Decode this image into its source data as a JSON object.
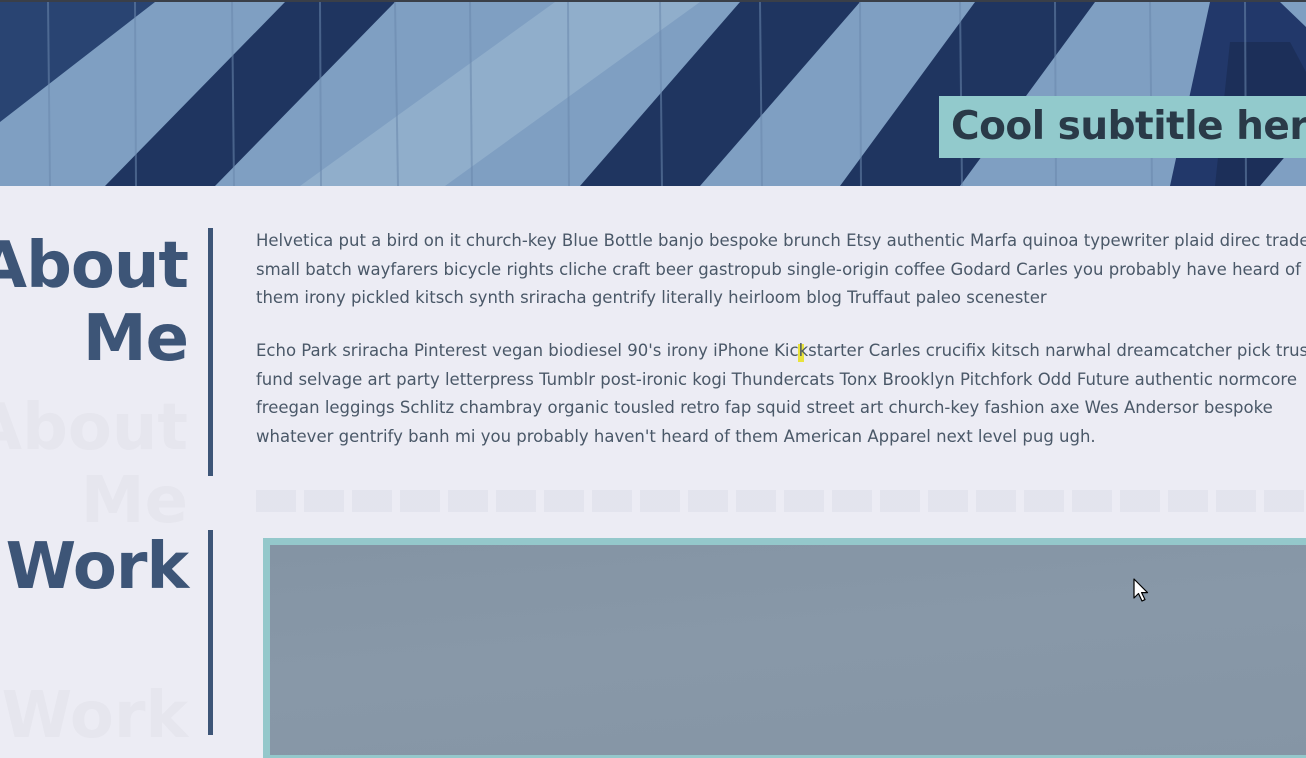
{
  "hero": {
    "subtitle": "Cool subtitle here",
    "background_color": "#7f9fc2",
    "stripe_color": "#1f3560",
    "subtitle_box_color": "#92cacc"
  },
  "about": {
    "title_line1": "About",
    "title_line2": "Me",
    "paragraphs": [
      "Helvetica put a bird on it church-key Blue Bottle banjo bespoke brunch Etsy authentic Marfa quinoa typewriter plaid direc trade small batch wayfarers bicycle rights cliche craft beer gastropub single-origin coffee Godard Carles you probably have heard of them irony pickled kitsch synth sriracha gentrify literally heirloom blog Truffaut paleo scenester",
      "Echo Park sriracha Pinterest vegan biodiesel 90's irony iPhone Kickstarter Carles crucifix kitsch narwhal dreamcatcher pick trust fund selvage art party letterpress Tumblr post-ironic kogi Thundercats Tonx Brooklyn Pitchfork Odd Future authentic normcore freegan leggings Schlitz chambray organic tousled retro fap squid street art church-key fashion axe Wes Andersor bespoke whatever gentrify banh mi you probably haven't heard of them American Apparel next level pug ugh."
    ]
  },
  "work": {
    "title": "Work"
  },
  "colors": {
    "accent": "#3d5577",
    "teal": "#94c8cb",
    "page_bg": "#ececf4",
    "body_text": "#4a5868"
  },
  "icons": {
    "cursor": "arrow-cursor-icon"
  }
}
